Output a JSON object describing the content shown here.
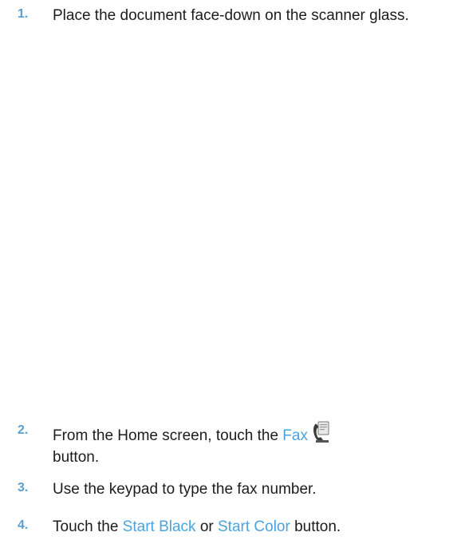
{
  "steps": [
    {
      "number": "1.",
      "text": "Place the document face-down on the scanner glass."
    },
    {
      "number": "2.",
      "pre": "From the Home screen, touch the ",
      "link": "Fax",
      "icon": "fax-icon",
      "post": "button."
    },
    {
      "number": "3.",
      "text": "Use the keypad to type the fax number."
    },
    {
      "number": "4.",
      "pre": "Touch the ",
      "link1": "Start Black",
      "mid": " or ",
      "link2": "Start Color",
      "post": " button."
    }
  ],
  "colors": {
    "number": "#5b9fd1",
    "link": "#4aa3df",
    "text": "#1c1c1c"
  }
}
